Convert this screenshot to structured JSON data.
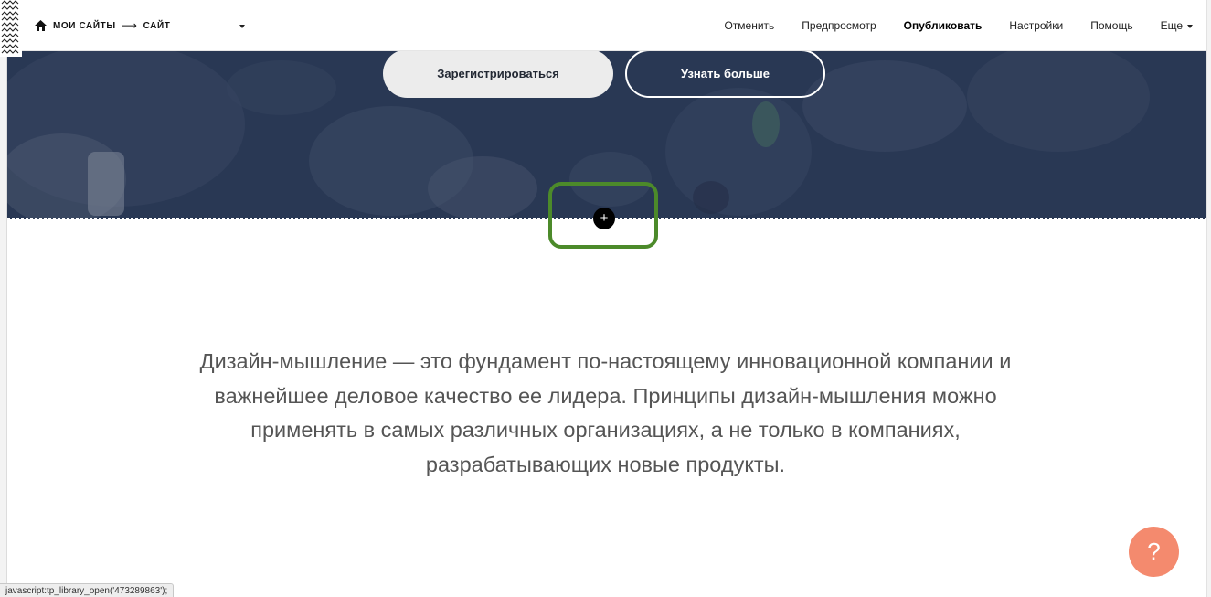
{
  "breadcrumb": {
    "my_sites": "Мои сайты",
    "arrow": "⟶",
    "site": "Сайт"
  },
  "menu": {
    "cancel": "Отменить",
    "preview": "Предпросмотр",
    "publish": "Опубликовать",
    "settings": "Настройки",
    "help": "Помощь",
    "more": "Еще"
  },
  "hero": {
    "register_label": "Зарегистрироваться",
    "learn_more_label": "Узнать больше"
  },
  "add_block": {
    "label": "+"
  },
  "content": {
    "paragraph": "Дизайн-мышление — это фундамент по-настоящему инновационной компании и важнейшее деловое качество ее лидера. Принципы дизайн-мышления можно применять в самых различных организациях, а не только в компаниях, разрабатывающих новые продукты."
  },
  "help_widget": {
    "label": "?"
  },
  "status_bar": {
    "text": "javascript:tp_library_open('473289863');"
  },
  "colors": {
    "hero_bg": "#2c3c57",
    "highlight_border": "#4c8a2a",
    "help_button": "#f48a6e",
    "body_text": "#555555"
  },
  "icons": [
    "home-icon",
    "chevron-down-icon",
    "plus-icon",
    "question-icon",
    "zigzag-logo-icon"
  ]
}
